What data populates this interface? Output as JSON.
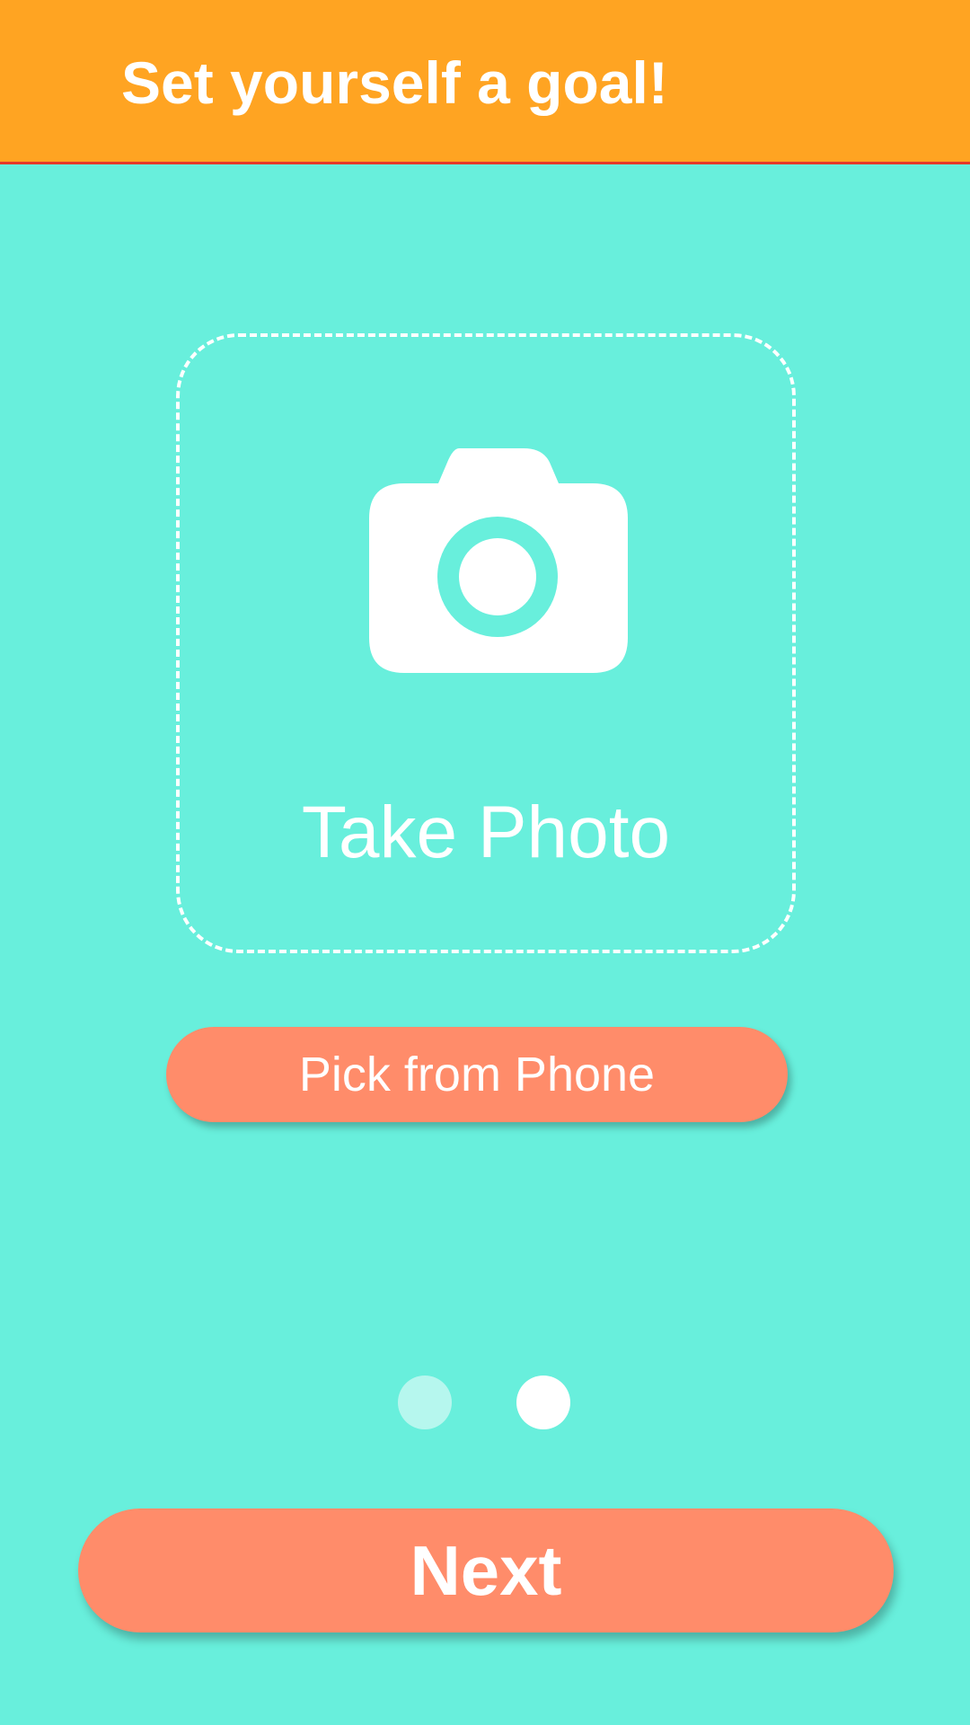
{
  "header": {
    "title": "Set yourself a goal!",
    "background_color": "#FFA422"
  },
  "photo_box": {
    "icon": "camera-icon",
    "label": "Take Photo"
  },
  "pick_button": {
    "label": "Pick from Phone",
    "color": "#FF8C6A"
  },
  "pagination": {
    "total_pages": 2,
    "current_page": 2
  },
  "next_button": {
    "label": "Next",
    "color": "#FF8C6A"
  },
  "colors": {
    "background": "#68EFDC",
    "accent": "#FF8C6A"
  }
}
